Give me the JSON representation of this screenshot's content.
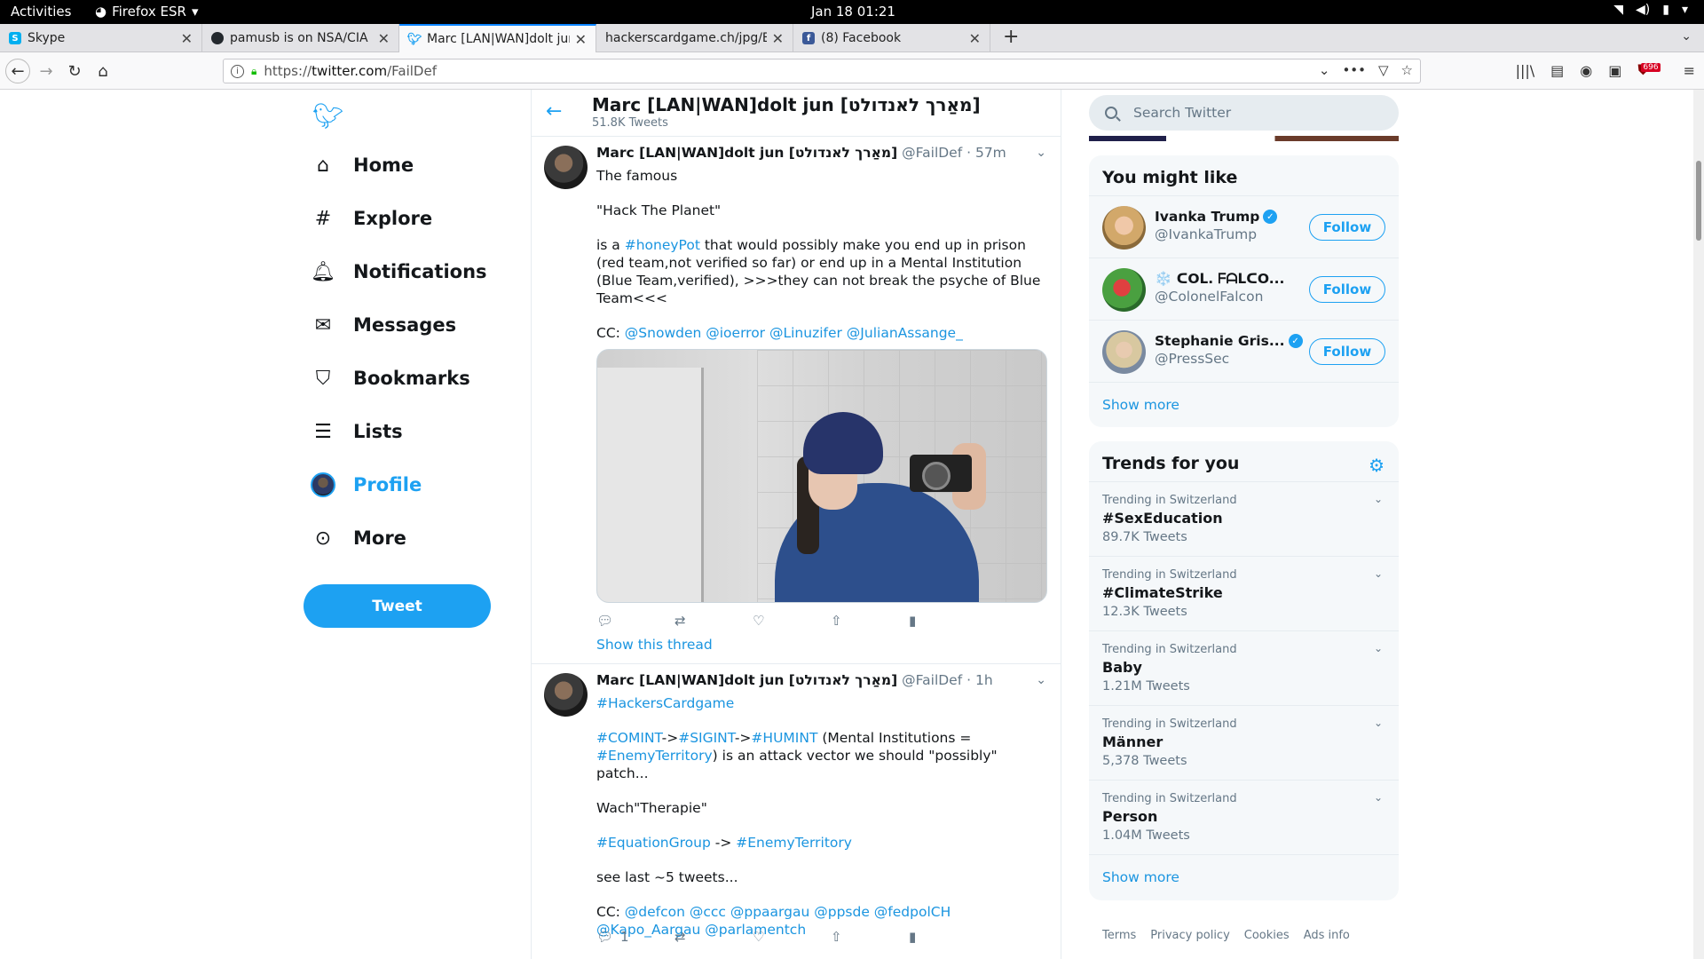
{
  "system": {
    "activities": "Activities",
    "app_menu": "Firefox ESR",
    "clock": "Jan 18  01:21"
  },
  "tabs": [
    {
      "title": "Skype",
      "icon": "skype-icon",
      "color": "#00aff0"
    },
    {
      "title": "pamusb is on NSA/CIA H",
      "icon": "github-icon",
      "color": "#24292e"
    },
    {
      "title": "Marc [LAN|WAN]dolt jun",
      "icon": "twitter-icon",
      "color": "#1da1f2",
      "active": true
    },
    {
      "title": "hackerscardgame.ch/jpg/EN",
      "icon": "",
      "color": "#e3e3e6"
    },
    {
      "title": "(8) Facebook",
      "icon": "facebook-icon",
      "color": "#3b5998"
    }
  ],
  "urlbar": {
    "prefix": "https://",
    "host": "twitter.com",
    "path": "/FailDef"
  },
  "tools": {
    "badge": "696"
  },
  "nav": {
    "items": [
      {
        "label": "Home",
        "icon": "home-icon"
      },
      {
        "label": "Explore",
        "icon": "hashtag-icon"
      },
      {
        "label": "Notifications",
        "icon": "bell-icon"
      },
      {
        "label": "Messages",
        "icon": "envelope-icon"
      },
      {
        "label": "Bookmarks",
        "icon": "bookmark-icon"
      },
      {
        "label": "Lists",
        "icon": "list-icon"
      },
      {
        "label": "Profile",
        "icon": "avatar"
      },
      {
        "label": "More",
        "icon": "more-icon"
      }
    ],
    "tweet_button": "Tweet"
  },
  "header": {
    "name": "Marc [LAN|WAN]dolt jun [מאַרך לאנדולט]",
    "count": "51.8K Tweets"
  },
  "tweets": [
    {
      "name": "Marc [LAN|WAN]dolt jun [מאַרך לאנדולט]",
      "handle": "@FailDef · 57m",
      "p1": "The famous",
      "p2": "\"Hack The Planet\"",
      "p3_pre": "is a ",
      "p3_tag": "#honeyPot",
      "p3_post": " that would possibly make you end up in prison (red team,not verified so far) or end up in a Mental Institution (Blue Team,verified), >>>they can not break the psyche of Blue Team<<<",
      "cc_label": "CC: ",
      "cc": "@Snowden @ioerror @Linuzifer  @JulianAssange_",
      "show_thread": "Show this thread"
    },
    {
      "name": "Marc [LAN|WAN]dolt jun [מאַרך לאנדולט]",
      "handle": "@FailDef · 1h",
      "tag1": "#HackersCardgame",
      "l2a": "#COMINT",
      "l2b": "->",
      "l2c": "#SIGINT",
      "l2d": "->",
      "l2e": "#HUMINT",
      "l2f": " (Mental Institutions = ",
      "l2g": "#EnemyTerritory",
      "l2h": ") is an attack vector we should \"possibly\" patch...",
      "l3": "Wach\"Therapie\"",
      "l4a": "#EquationGroup",
      "l4b": " -> ",
      "l4c": "#EnemyTerritory",
      "l5": "see last ~5 tweets...",
      "cc_label": "CC: ",
      "cc": "@defcon @ccc @ppaargau @ppsde @fedpolCH @Kapo_Aargau @parlamentch",
      "reply_count": "1"
    }
  ],
  "search": {
    "placeholder": "Search Twitter"
  },
  "suggestions": {
    "title": "You might like",
    "users": [
      {
        "name": "Ivanka Trump",
        "handle": "@IvankaTrump",
        "verified": true,
        "follow": "Follow"
      },
      {
        "name": "❄️ ᑕOᒪ. ᖴᗩᒪᑕO...",
        "handle": "@ColonelFalcon",
        "verified": false,
        "follow": "Follow"
      },
      {
        "name": "Stephanie Gris...",
        "handle": "@PressSec",
        "verified": true,
        "follow": "Follow"
      }
    ],
    "show_more": "Show more"
  },
  "trends": {
    "title": "Trends for you",
    "items": [
      {
        "context": "Trending in Switzerland",
        "name": "#SexEducation",
        "count": "89.7K Tweets"
      },
      {
        "context": "Trending in Switzerland",
        "name": "#ClimateStrike",
        "count": "12.3K Tweets"
      },
      {
        "context": "Trending in Switzerland",
        "name": "Baby",
        "count": "1.21M Tweets"
      },
      {
        "context": "Trending in Switzerland",
        "name": "Männer",
        "count": "5,378 Tweets"
      },
      {
        "context": "Trending in Switzerland",
        "name": "Person",
        "count": "1.04M Tweets"
      }
    ],
    "show_more": "Show more"
  },
  "footer": {
    "links": [
      "Terms",
      "Privacy policy",
      "Cookies",
      "Ads info"
    ]
  }
}
